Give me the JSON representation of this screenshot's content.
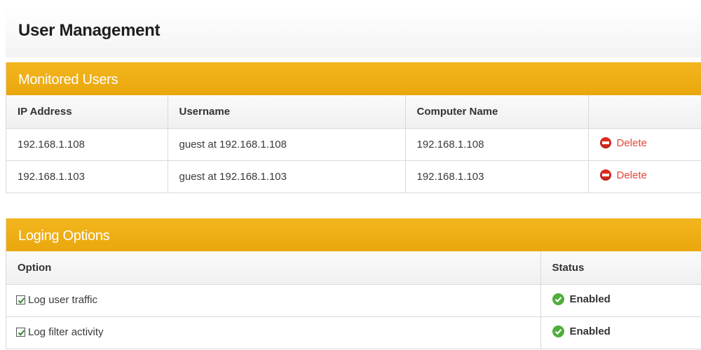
{
  "page": {
    "title": "User Management"
  },
  "monitored_users": {
    "title": "Monitored Users",
    "columns": [
      "IP Address",
      "Username",
      "Computer Name",
      ""
    ],
    "rows": [
      {
        "ip": "192.168.1.108",
        "username": "guest at 192.168.1.108",
        "computer": "192.168.1.108",
        "action": "Delete"
      },
      {
        "ip": "192.168.1.103",
        "username": "guest at 192.168.1.103",
        "computer": "192.168.1.103",
        "action": "Delete"
      }
    ]
  },
  "logging_options": {
    "title": "Loging Options",
    "columns": [
      "Option",
      "Status"
    ],
    "rows": [
      {
        "option": "Log user traffic",
        "checked": true,
        "status": "Enabled"
      },
      {
        "option": "Log filter activity",
        "checked": true,
        "status": "Enabled"
      }
    ]
  },
  "colors": {
    "panel_header": "#f0ae18",
    "delete_text": "#e0473a",
    "delete_icon": "#e02a1e",
    "enabled_icon": "#4fae3a",
    "checkbox_tick": "#2a8a2a"
  },
  "icons": {
    "delete": "delete-circle-icon",
    "status_ok": "check-circle-icon",
    "checkbox": "checkbox-checked-icon"
  }
}
